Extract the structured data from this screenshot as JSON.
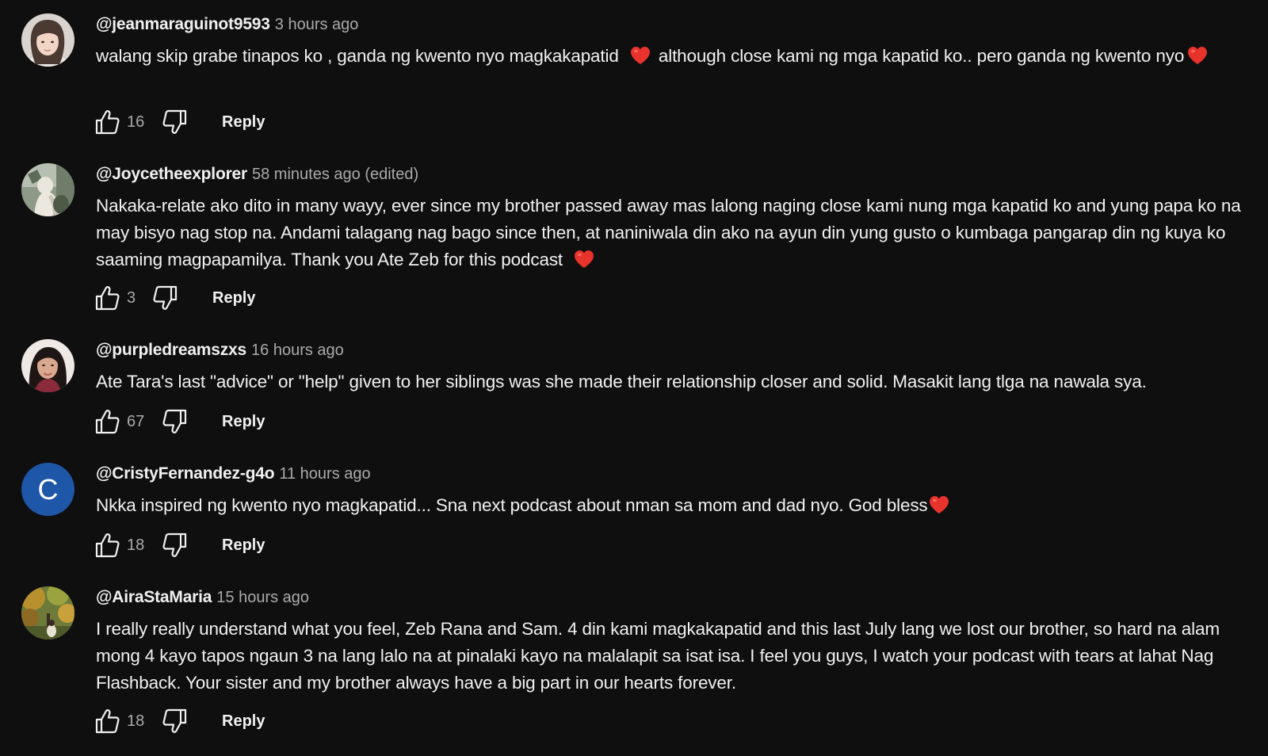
{
  "comments": [
    {
      "author": "@jeanmaraguinot9593",
      "time": "3 hours ago",
      "text_part1": "walang skip grabe tinapos ko , ganda ng kwento nyo magkakapatid",
      "text_part2": "although close kami ng mga kapatid ko.. pero ganda ng kwento nyo",
      "likes": "16",
      "reply_label": "Reply",
      "avatar": "photo-avatar"
    },
    {
      "author": "@Joycetheexplorer",
      "time": "58 minutes ago (edited)",
      "text_part1": "Nakaka-relate ako dito in many wayy, ever since my brother passed away mas lalong naging close kami nung mga kapatid ko and yung papa ko na may bisyo nag stop na.  Andami talagang nag bago since then, at naniniwala din ako na ayun din yung gusto o kumbaga pangarap din ng kuya ko saaming magpapamilya. Thank you Ate Zeb for this podcast",
      "likes": "3",
      "reply_label": "Reply",
      "avatar": "photo-avatar"
    },
    {
      "author": "@purpledreamszxs",
      "time": "16 hours ago",
      "text_part1": "Ate Tara's last \"advice\" or \"help\" given to her siblings was she made their relationship closer and solid. Masakit lang tlga na nawala sya.",
      "likes": "67",
      "reply_label": "Reply",
      "avatar": "photo-avatar"
    },
    {
      "author": "@CristyFernandez-g4o",
      "time": "11 hours ago",
      "text_part1": "Nkka inspired ng kwento nyo magkapatid... Sna next podcast about nman sa mom and dad nyo. God bless",
      "likes": "18",
      "reply_label": "Reply",
      "avatar_letter": "C"
    },
    {
      "author": "@AiraStaMaria",
      "time": "15 hours ago",
      "text_part1": "I really really understand what you feel, Zeb Rana and Sam. 4 din kami magkakapatid and this last July lang we lost our brother, so hard na alam mong 4 kayo tapos ngaun 3 na lang lalo na at pinalaki kayo na malalapit sa isat isa. I feel you guys, I watch your podcast with tears at lahat Nag Flashback. Your sister and my brother always have a big part in our hearts forever.",
      "likes": "18",
      "reply_label": "Reply",
      "avatar": "photo-avatar"
    }
  ],
  "icons": {
    "like": "thumbs-up-icon",
    "dislike": "thumbs-down-icon",
    "heart": "red-heart-emoji"
  },
  "colors": {
    "background": "#0f0f0f",
    "text": "#f1f1f1",
    "secondary_text": "#aaaaaa",
    "heart": "#e8332c",
    "letter_avatar": "#1e56a8"
  }
}
